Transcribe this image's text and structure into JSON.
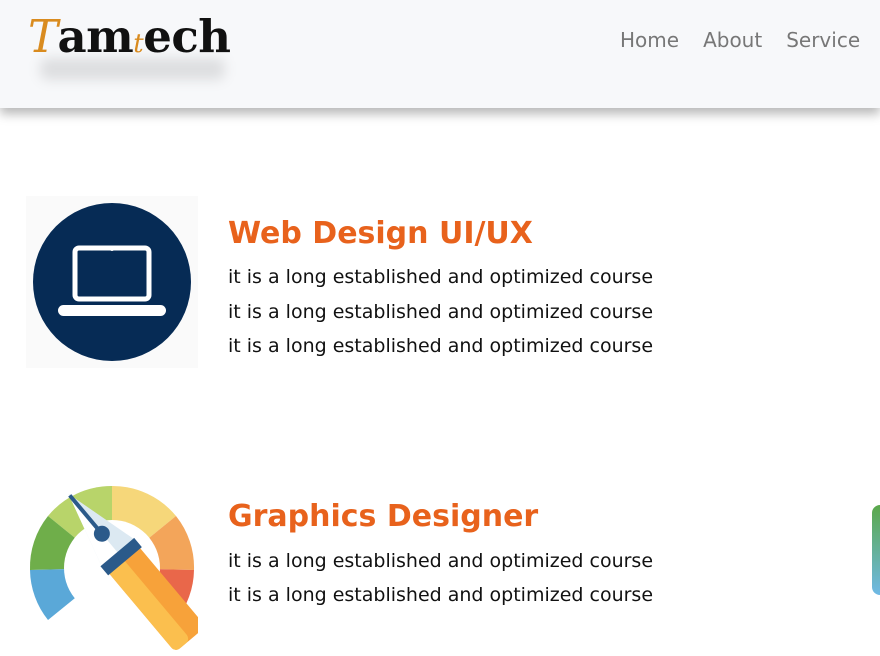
{
  "header": {
    "logo": {
      "t": "T",
      "am": "am",
      "t_small": "t",
      "ech": "ech"
    },
    "nav": [
      {
        "label": "Home"
      },
      {
        "label": "About"
      },
      {
        "label": "Service"
      }
    ]
  },
  "courses": [
    {
      "title": "Web Design UI/UX",
      "icon": "laptop-icon",
      "colors": {
        "circle": "#062b55",
        "laptop": "#ffffff"
      },
      "lines": [
        "it is a long established and optimized course",
        "it is a long established and optimized course",
        "it is a long established and optimized course"
      ]
    },
    {
      "title": "Graphics Designer",
      "icon": "pen-tool-icon",
      "lines": [
        "it is a long established and optimized course",
        "it is a long established and optimized course"
      ]
    }
  ],
  "colors": {
    "accent": "#e8621c",
    "logo_accent": "#d98b1f",
    "nav_text": "#777777",
    "header_bg": "#f7f8fa"
  }
}
